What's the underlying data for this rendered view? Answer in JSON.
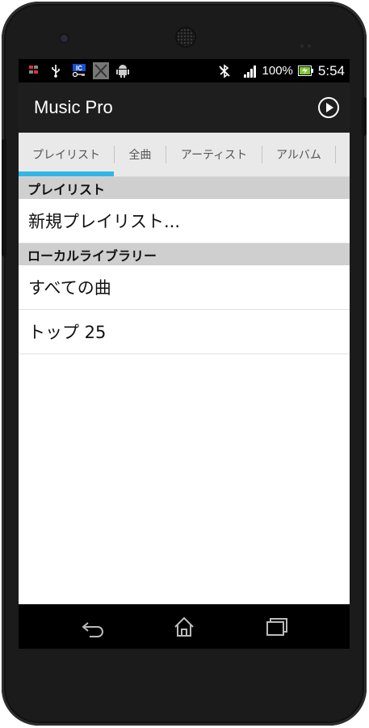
{
  "statusbar": {
    "icons_left": [
      "sim-icon",
      "usb-icon",
      "ic-icon",
      "app-icon",
      "android-icon"
    ],
    "battery_percent": "100%",
    "time": "5:54"
  },
  "appbar": {
    "title": "Music Pro",
    "play_icon": "play-circle-icon"
  },
  "tabs": [
    {
      "label": "プレイリスト",
      "selected": true
    },
    {
      "label": "全曲",
      "selected": false
    },
    {
      "label": "アーティスト",
      "selected": false
    },
    {
      "label": "アルバム",
      "selected": false
    }
  ],
  "sections": [
    {
      "header": "プレイリスト",
      "items": [
        "新規プレイリスト..."
      ]
    },
    {
      "header": "ローカルライブラリー",
      "items": [
        "すべての曲",
        "トップ 25"
      ]
    }
  ],
  "navbar": {
    "back_icon": "back-icon",
    "home_icon": "home-icon",
    "recents_icon": "recents-icon"
  },
  "colors": {
    "accent": "#33b5e5",
    "appbar": "#1e1e1e",
    "tabs_bg": "#e9e9e9",
    "section_bg": "#cfcfcf"
  }
}
